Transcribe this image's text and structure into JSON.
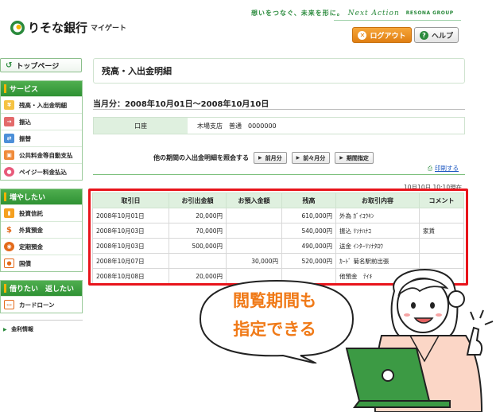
{
  "header": {
    "logo_text": "りそな銀行",
    "logo_sub": "マイゲート",
    "tagline": "想いをつなぐ、未来を形に。",
    "tagline_brand": "Next Action",
    "group": "RESONA GROUP",
    "logout_label": "ログアウト",
    "help_label": "ヘルプ"
  },
  "sidebar": {
    "top_label": "トップページ",
    "sections": [
      {
        "title": "サービス",
        "items": [
          {
            "label": "残高・入出金明細",
            "icon": "coins-icon"
          },
          {
            "label": "振込",
            "icon": "transfer-icon"
          },
          {
            "label": "振替",
            "icon": "swap-icon"
          },
          {
            "label": "公共料金等自動支払",
            "icon": "bill-icon"
          },
          {
            "label": "ペイジー料金払込",
            "icon": "payeasy-icon"
          }
        ]
      },
      {
        "title": "増やしたい",
        "items": [
          {
            "label": "投資信託",
            "icon": "bar-chart-icon"
          },
          {
            "label": "外貨預金",
            "icon": "dollar-icon"
          },
          {
            "label": "定期預金",
            "icon": "deposit-icon"
          },
          {
            "label": "国債",
            "icon": "bond-icon"
          }
        ]
      },
      {
        "title": "借りたい　返したい",
        "items": [
          {
            "label": "カードローン",
            "icon": "card-icon"
          }
        ]
      }
    ],
    "kinri_label": "金利情報"
  },
  "main": {
    "title": "残高・入出金明細",
    "period": "当月分：2008年10月01日～2008年10月10日",
    "account_header": "口座",
    "account_value": "木場支店　普通　0000000",
    "nav_prompt": "他の期間の入出金明細を照会する",
    "nav_buttons": [
      "前月分",
      "前々月分",
      "期間指定"
    ],
    "print_label": "印刷する",
    "asof": "10月10日 10:10現在"
  },
  "table": {
    "headers": [
      "取引日",
      "お引出金額",
      "お預入金額",
      "残高",
      "お取引内容",
      "コメント"
    ],
    "rows": [
      [
        "2008年10月01日",
        "20,000円",
        "",
        "610,000円",
        "外為 ｶﾞｲｺｳｷﾝ",
        ""
      ],
      [
        "2008年10月03日",
        "70,000円",
        "",
        "540,000円",
        "振込 ﾘｿﾅﾊﾅｺ",
        "家賃"
      ],
      [
        "2008年10月03日",
        "500,000円",
        "",
        "490,000円",
        "送金 ｲﾝﾀｰﾘｿﾅﾀﾛｳ",
        ""
      ],
      [
        "2008年10月07日",
        "",
        "30,000円",
        "520,000円",
        "ｶｰﾄﾞ 菊名駅前出張",
        ""
      ],
      [
        "2008年10月08日",
        "20,000円",
        "",
        "",
        "他預金　ﾃｲｷ",
        ""
      ]
    ]
  },
  "callout": {
    "line1": "閲覧期間も",
    "line2": "指定できる"
  },
  "colors": {
    "accent_green": "#2f9234",
    "highlight_red": "#e8141b",
    "callout_orange": "#f07a18",
    "logout_orange": "#e07f12"
  }
}
